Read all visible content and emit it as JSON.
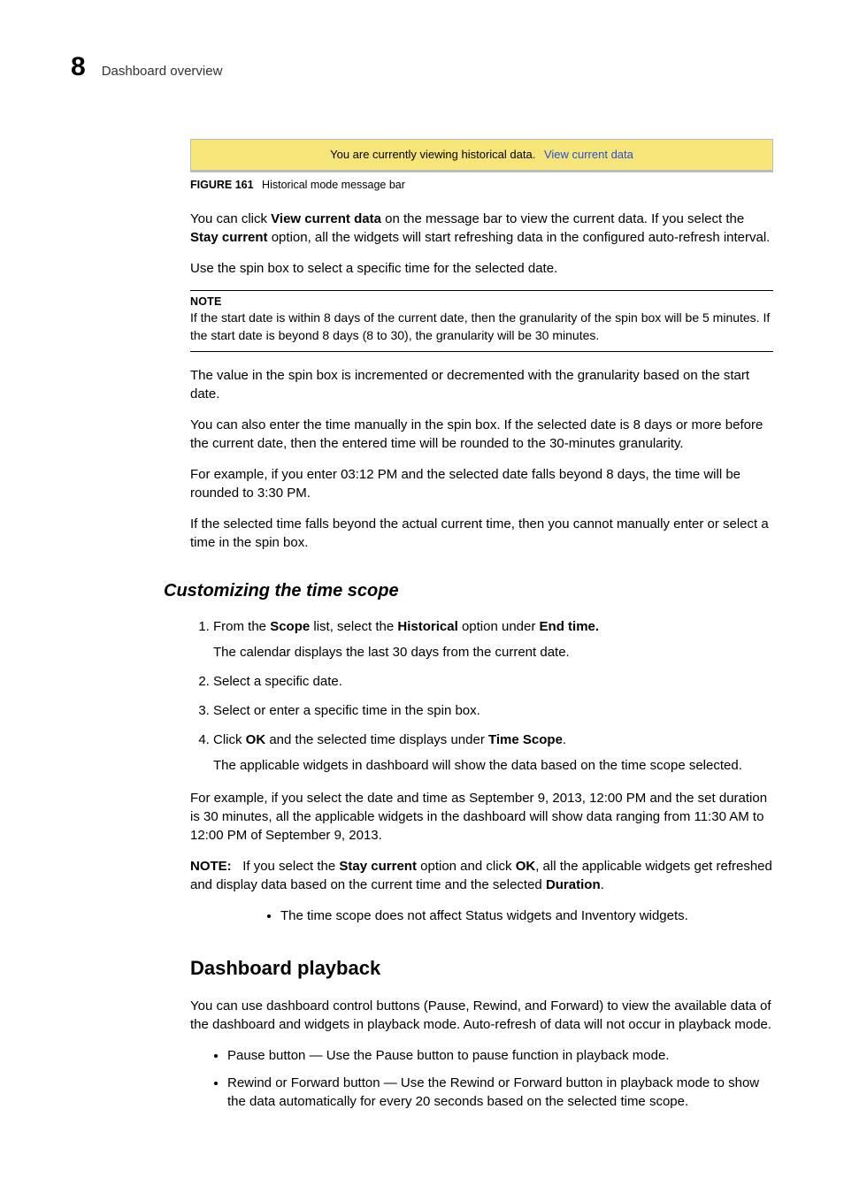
{
  "header": {
    "chapter_num": "8",
    "section_title": "Dashboard overview"
  },
  "message_bar": {
    "text": "You are currently viewing historical data.",
    "link_label": "View current data"
  },
  "figure": {
    "label": "FIGURE 161",
    "caption": "Historical mode message bar"
  },
  "body": {
    "p1a": "You can click ",
    "p1b": "View current data",
    "p1c": " on the message bar to view the current data. If you select the ",
    "p1d": "Stay current",
    "p1e": " option, all the widgets will start refreshing data in the configured auto-refresh interval.",
    "p2": "Use the spin box to select a specific time for the selected date.",
    "note_label": "NOTE",
    "note_text": "If the start date is within 8 days of the current date, then the granularity of the spin box will be 5 minutes. If the start date is beyond 8 days (8 to 30), the granularity will be 30 minutes.",
    "p3": "The value in the spin box is incremented or decremented with the granularity based on the start date.",
    "p4": "You can also enter the time manually in the spin box. If the selected date is 8 days or more before the current date, then the entered time will be rounded to the 30-minutes granularity.",
    "p5": "For example, if you enter 03:12 PM and the selected date falls beyond 8 days, the time will be rounded to 3:30 PM.",
    "p6": "If the selected time falls beyond the actual current time, then you cannot manually enter or select a time in the spin box."
  },
  "customize": {
    "heading": "Customizing the time scope",
    "step1a": "From the ",
    "step1b": "Scope",
    "step1c": " list, select the ",
    "step1d": "Historical",
    "step1e": " option under ",
    "step1f": "End time.",
    "step1_sub": "The calendar displays the last 30 days from the current date.",
    "step2": "Select a specific date.",
    "step3": "Select or enter a specific time in the spin box.",
    "step4a": "Click ",
    "step4b": "OK",
    "step4c": " and the selected time displays under ",
    "step4d": "Time Scope",
    "step4e": ".",
    "step4_sub": "The applicable widgets in dashboard will show the data based on the time scope selected.",
    "example": "For example, if you select the date and time as September 9, 2013, 12:00 PM and the set duration is 30 minutes, all the applicable widgets in the dashboard will show data ranging from 11:30 AM to 12:00 PM of September 9, 2013.",
    "note_prefix": "NOTE:",
    "note_a": "If you select the ",
    "note_b": "Stay current",
    "note_c": " option and click ",
    "note_d": "OK",
    "note_e": ", all the applicable widgets get refreshed and display data based on the current time and the selected ",
    "note_f": "Duration",
    "note_g": ".",
    "bullet": "The time scope does not affect Status widgets and Inventory widgets."
  },
  "playback": {
    "heading": "Dashboard playback",
    "intro": "You can use dashboard control buttons (Pause, Rewind, and Forward) to view the available data of the dashboard and widgets in playback mode. Auto-refresh of data will not occur in playback mode.",
    "b1": "Pause button — Use the Pause button to pause function in playback mode.",
    "b2": "Rewind or Forward button — Use the Rewind or Forward button in playback mode to show the data automatically for every 20 seconds based on the selected time scope."
  }
}
